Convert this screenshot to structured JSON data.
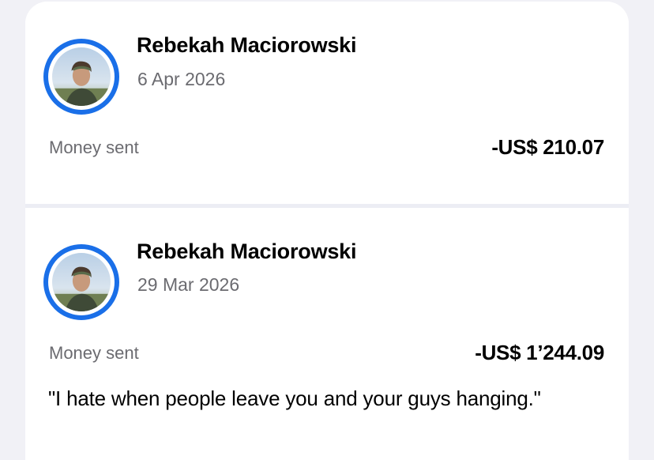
{
  "colors": {
    "accent": "#1a6fe8",
    "background": "#f1f1f6",
    "card": "#ffffff",
    "muted_text": "#6b6b70"
  },
  "transactions": [
    {
      "name": "Rebekah Maciorowski",
      "date": "6 Apr 2026",
      "type": "Money sent",
      "amount": "-US$ 210.07",
      "avatar_icon": "profile-photo"
    },
    {
      "name": "Rebekah Maciorowski",
      "date": "29 Mar 2026",
      "type": "Money sent",
      "amount": "-US$ 1’244.09",
      "note": "\"I hate when people leave you and your guys hanging.\"",
      "avatar_icon": "profile-photo"
    }
  ]
}
